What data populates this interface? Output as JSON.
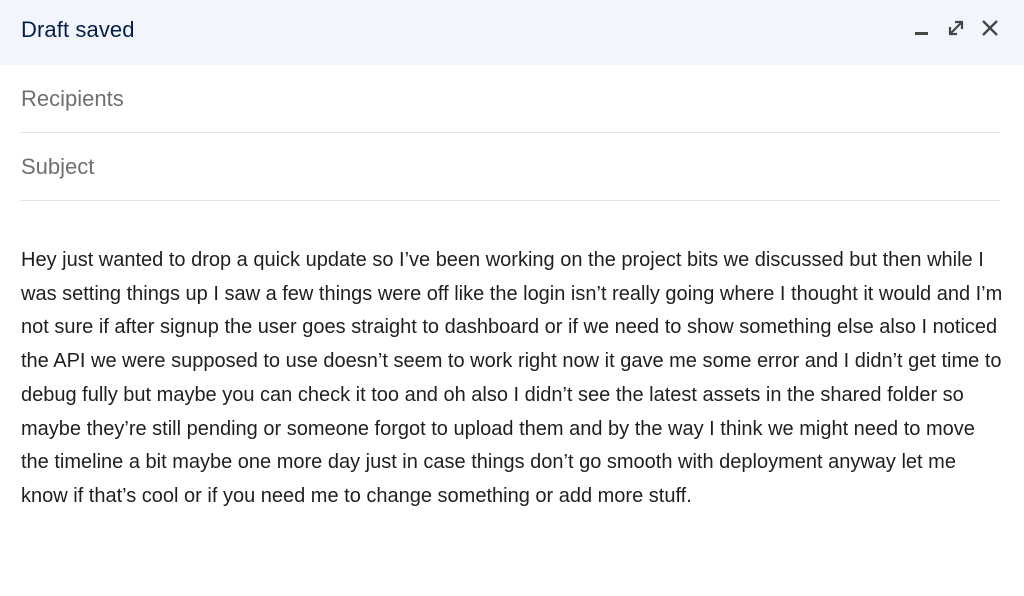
{
  "header": {
    "title": "Draft saved",
    "controls": [
      {
        "icon": "minimize-icon",
        "name": "minimize"
      },
      {
        "icon": "expand-icon",
        "name": "full-screen"
      },
      {
        "icon": "close-icon",
        "name": "close"
      }
    ]
  },
  "fields": {
    "recipients_placeholder": "Recipients",
    "recipients_value": "",
    "subject_placeholder": "Subject",
    "subject_value": ""
  },
  "body": {
    "text": "Hey just wanted to drop a quick update so I’ve been working on the project bits we discussed but then while I was setting things up I saw a few things were off like the login isn’t really going where I thought it would and I’m not sure if after signup the user goes straight to dashboard or if we need to show something else also I noticed the API we were supposed to use doesn’t seem to work right now it gave me some error and I didn’t get time to debug fully but maybe you can check it too and oh also I didn’t see the latest assets in the shared folder so maybe they’re still pending or someone forgot to upload them and by the way I think we might need to move the timeline a bit maybe one more day just in case things don’t go smooth with deployment anyway let me know if that’s cool or if you need me to change something or add more stuff."
  },
  "colors": {
    "header_bg": "#f2f6fc",
    "title": "#041e49",
    "icon": "#444746",
    "divider": "#e3e3e3",
    "body_text": "#1f1f1f"
  }
}
